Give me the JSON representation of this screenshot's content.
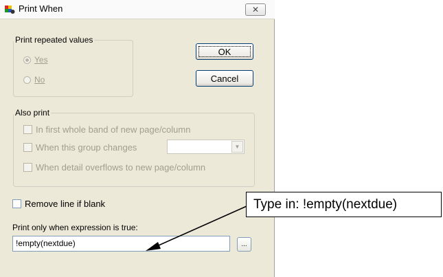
{
  "window": {
    "title": "Print When",
    "close_icon": "close-icon",
    "app_icon": "report-app-icon"
  },
  "print_repeated": {
    "group_label": "Print repeated values",
    "options": [
      {
        "label": "Yes",
        "selected": true
      },
      {
        "label": "No",
        "selected": false
      }
    ]
  },
  "buttons": {
    "ok": "OK",
    "cancel": "Cancel",
    "expression_builder": "..."
  },
  "also_print": {
    "group_label": "Also print",
    "first_band": "In first whole band of new page/column",
    "group_changes": "When this group changes",
    "group_select_value": "",
    "detail_overflows": "When detail overflows to new page/column"
  },
  "remove_line": {
    "label": "Remove line if blank",
    "checked": false
  },
  "expression": {
    "label": "Print only when expression is true:",
    "value": "!empty(nextdue)"
  },
  "annotation": {
    "callout": "Type in: !empty(nextdue)"
  },
  "colors": {
    "dialog_bg": "#ece9d8",
    "disabled_text": "#a19e90",
    "button_border": "#003c74"
  }
}
